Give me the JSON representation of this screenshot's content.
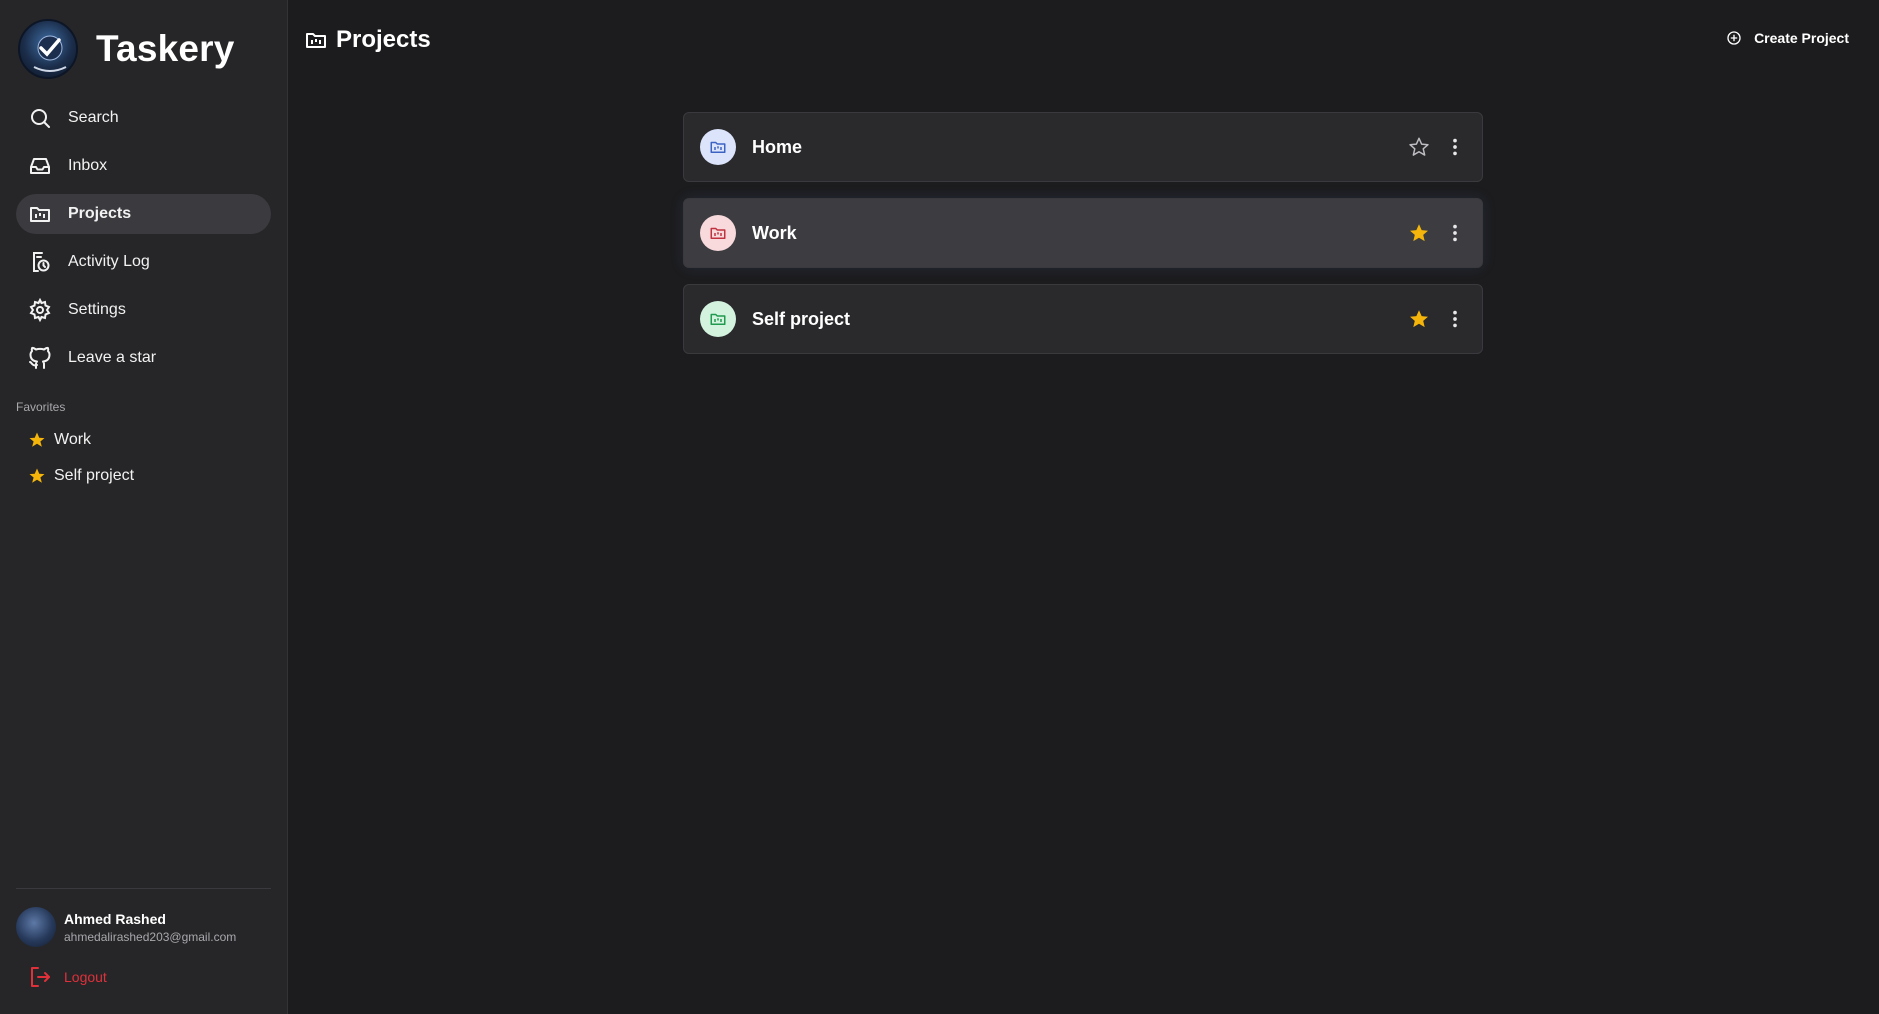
{
  "app": {
    "name": "Taskery"
  },
  "nav": [
    {
      "label": "Search",
      "icon": "search-icon",
      "active": false
    },
    {
      "label": "Inbox",
      "icon": "inbox-icon",
      "active": false
    },
    {
      "label": "Projects",
      "icon": "projects-icon",
      "active": true
    },
    {
      "label": "Activity Log",
      "icon": "activity-log-icon",
      "active": false
    },
    {
      "label": "Settings",
      "icon": "gear-icon",
      "active": false
    },
    {
      "label": "Leave a star",
      "icon": "github-icon",
      "active": false
    }
  ],
  "favorites": {
    "heading": "Favorites",
    "items": [
      {
        "label": "Work"
      },
      {
        "label": "Self project"
      }
    ]
  },
  "user": {
    "name": "Ahmed Rashed",
    "email": "ahmedalirashed203@gmail.com"
  },
  "logout": {
    "label": "Logout"
  },
  "page": {
    "title": "Projects",
    "create_label": "Create Project"
  },
  "projects": [
    {
      "name": "Home",
      "favorite": false,
      "icon_bg": "#dbe4fb",
      "icon_color": "#3c63c4"
    },
    {
      "name": "Work",
      "favorite": true,
      "icon_bg": "#f8d9dc",
      "icon_color": "#c0323f"
    },
    {
      "name": "Self project",
      "favorite": true,
      "icon_bg": "#d3f3df",
      "icon_color": "#1f9a4e"
    }
  ],
  "colors": {
    "star": "#f5b50a",
    "logout": "#e0303a",
    "active_nav": "#3a3a3f"
  }
}
